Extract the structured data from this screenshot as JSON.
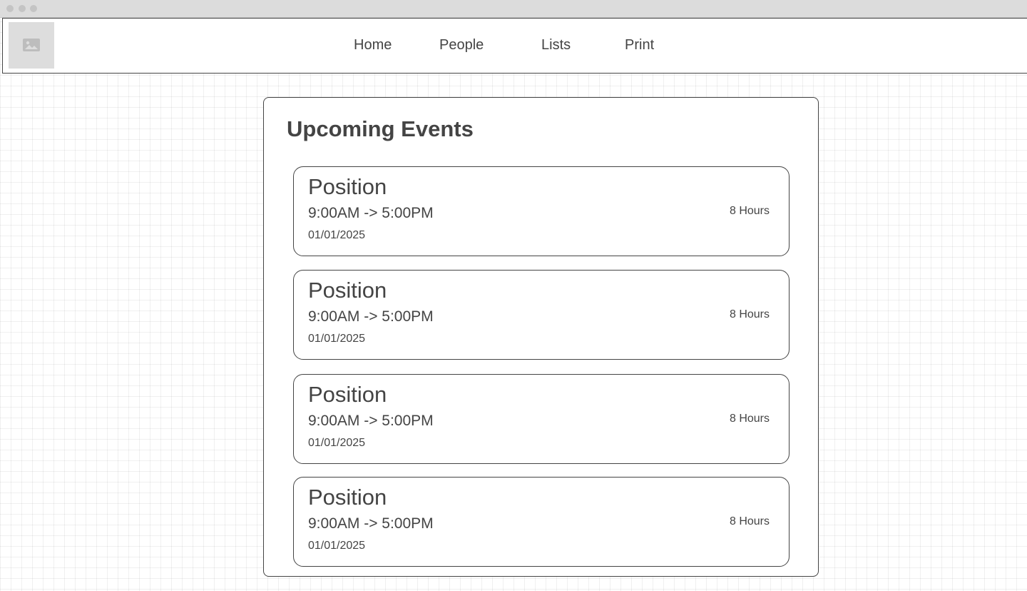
{
  "window": {
    "controls": [
      "close",
      "minimize",
      "maximize"
    ]
  },
  "header": {
    "logo_icon": "image-placeholder-icon",
    "nav": [
      {
        "label": "Home"
      },
      {
        "label": "People"
      },
      {
        "label": "Lists"
      },
      {
        "label": "Print"
      }
    ]
  },
  "main": {
    "title": "Upcoming Events",
    "events": [
      {
        "title": "Position",
        "time": "9:00AM -> 5:00PM",
        "date": "01/01/2025",
        "duration": "8 Hours"
      },
      {
        "title": "Position",
        "time": "9:00AM -> 5:00PM",
        "date": "01/01/2025",
        "duration": "8 Hours"
      },
      {
        "title": "Position",
        "time": "9:00AM -> 5:00PM",
        "date": "01/01/2025",
        "duration": "8 Hours"
      },
      {
        "title": "Position",
        "time": "9:00AM -> 5:00PM",
        "date": "01/01/2025",
        "duration": "8 Hours"
      }
    ]
  },
  "colors": {
    "text": "#444444",
    "border": "#444444",
    "placeholder": "#dddddd",
    "titlebar": "#dcdcdc"
  }
}
